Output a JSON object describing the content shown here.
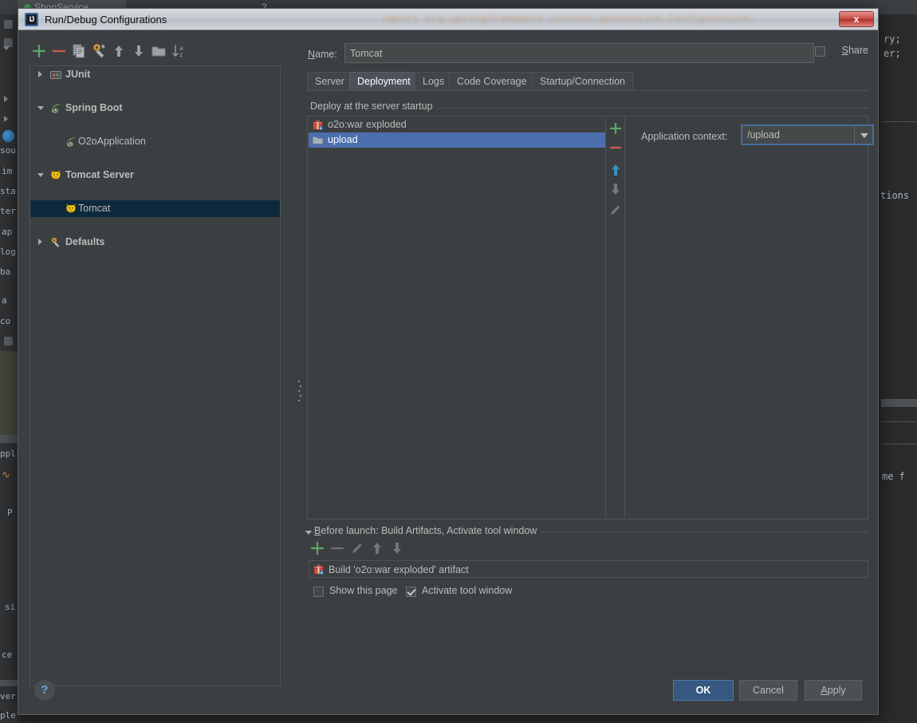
{
  "background": {
    "editor_tabs": [
      {
        "label": "ShopService",
        "icon": "class-icon",
        "active": true
      },
      {
        "label": "2",
        "icon": "",
        "active": false
      }
    ],
    "code_lines": [
      "ry;",
      "er;",
      "tions",
      "me f"
    ],
    "gutter_labels": [
      "sou",
      "im",
      "sta",
      "ter",
      "ap",
      "log",
      "ba",
      "a",
      "co",
      "P",
      "si",
      "ce",
      "ver",
      "ple"
    ],
    "title_glass_code": "import org.springframework.context.annotation.Configuration;",
    "run_panel_label": "ppli"
  },
  "dialog": {
    "title": "Run/Debug Configurations",
    "title_icon": "intellij-idea-icon",
    "close_label": "x",
    "tree_toolbar": [
      {
        "name": "add-configuration-button",
        "icon": "plus-icon"
      },
      {
        "name": "remove-configuration-button",
        "icon": "minus-icon"
      },
      {
        "name": "copy-configuration-button",
        "icon": "copy-icon"
      },
      {
        "name": "save-configuration-button",
        "icon": "wrench-gear-icon"
      },
      {
        "name": "move-up-button",
        "icon": "arrow-up-icon"
      },
      {
        "name": "move-down-button",
        "icon": "arrow-down-icon"
      },
      {
        "name": "create-folder-button",
        "icon": "folder-icon"
      },
      {
        "name": "sort-configurations-button",
        "icon": "sort-az-icon"
      }
    ],
    "tree": [
      {
        "label": "JUnit",
        "icon": "junit-icon",
        "indent": 0,
        "twisty": "right",
        "bold": true,
        "selected": false
      },
      {
        "label": "Spring Boot",
        "icon": "spring-icon",
        "indent": 0,
        "twisty": "down",
        "bold": true,
        "selected": false
      },
      {
        "label": "O2oApplication",
        "icon": "spring-icon",
        "indent": 1,
        "twisty": "none",
        "bold": false,
        "selected": false
      },
      {
        "label": "Tomcat Server",
        "icon": "tomcat-icon",
        "indent": 0,
        "twisty": "down",
        "bold": true,
        "selected": false
      },
      {
        "label": "Tomcat",
        "icon": "tomcat-icon",
        "indent": 1,
        "twisty": "none",
        "bold": false,
        "selected": true
      },
      {
        "label": "Defaults",
        "icon": "wrench-gear-icon",
        "indent": 0,
        "twisty": "right",
        "bold": true,
        "selected": false
      }
    ],
    "name": {
      "label": "Name:",
      "label_mnemonic": "N",
      "value": "Tomcat",
      "placeholder": ""
    },
    "share": {
      "label": "Share",
      "label_mnemonic": "S",
      "checked": false
    },
    "tabs": [
      {
        "label": "Server",
        "active": false
      },
      {
        "label": "Deployment",
        "active": true
      },
      {
        "label": "Logs",
        "active": false
      },
      {
        "label": "Code Coverage",
        "active": false
      },
      {
        "label": "Startup/Connection",
        "active": false
      }
    ],
    "deployment": {
      "group_title": "Deploy at the server startup",
      "items": [
        {
          "label": "o2o:war exploded",
          "icon": "artifact-icon",
          "selected": false
        },
        {
          "label": "upload",
          "icon": "folder-icon",
          "selected": true
        }
      ],
      "list_buttons": [
        {
          "name": "add-artifact-button",
          "icon": "plus-icon",
          "enabled": true
        },
        {
          "name": "remove-artifact-button",
          "icon": "minus-icon",
          "enabled": true
        },
        {
          "name": "move-artifact-up-button",
          "icon": "arrow-up-icon",
          "enabled": true
        },
        {
          "name": "move-artifact-down-button",
          "icon": "arrow-down-icon",
          "enabled": false
        },
        {
          "name": "edit-artifact-button",
          "icon": "pencil-icon",
          "enabled": false
        }
      ],
      "application_context": {
        "label": "Application context:",
        "value": "/upload",
        "options": [
          "/upload"
        ]
      }
    },
    "before_launch": {
      "title": "Before launch: Build Artifacts, Activate tool window",
      "title_mnemonic": "B",
      "toolbar": [
        {
          "name": "add-task-button",
          "icon": "plus-icon",
          "enabled": true
        },
        {
          "name": "remove-task-button",
          "icon": "minus-icon",
          "enabled": false
        },
        {
          "name": "edit-task-button",
          "icon": "pencil-icon",
          "enabled": false
        },
        {
          "name": "task-move-up-button",
          "icon": "arrow-up-icon",
          "enabled": false
        },
        {
          "name": "task-move-down-button",
          "icon": "arrow-down-icon",
          "enabled": false
        }
      ],
      "tasks": [
        {
          "label": "Build 'o2o:war exploded' artifact",
          "icon": "artifact-icon"
        }
      ],
      "show_this_page": {
        "label": "Show this page",
        "checked": false
      },
      "activate_tool_window": {
        "label": "Activate tool window",
        "checked": true
      }
    },
    "footer": {
      "help_label": "?",
      "ok_label": "OK",
      "cancel_label": "Cancel",
      "apply_label": "Apply",
      "apply_mnemonic": "A"
    }
  },
  "colors": {
    "dialog_bg": "#3c3f41",
    "selection_blue": "#4b6eaf",
    "tree_selection": "#0d293e",
    "primary_button": "#365880",
    "accent_green": "#59a869",
    "accent_red": "#cc5b54",
    "accent_blue": "#3592c4",
    "focus_border": "#466d9c"
  }
}
